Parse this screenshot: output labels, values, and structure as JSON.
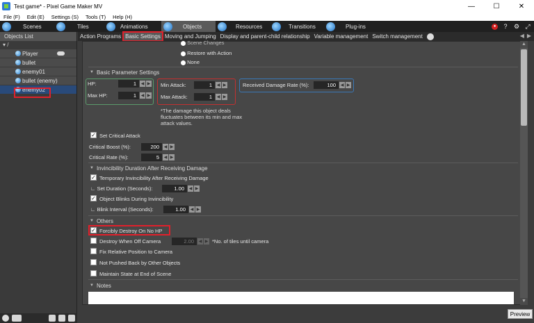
{
  "window": {
    "title": "Test game* - Pixel Game Maker MV",
    "minimize": "—",
    "maximize": "☐",
    "close": "✕"
  },
  "menu": [
    "File (F)",
    "Edit (E)",
    "Settings (S)",
    "Tools (T)",
    "Help (H)"
  ],
  "main_tabs": [
    {
      "label": "Scenes",
      "active": false
    },
    {
      "label": "Tiles",
      "active": false
    },
    {
      "label": "Animations",
      "active": false
    },
    {
      "label": "Objects",
      "active": true
    },
    {
      "label": "Resources",
      "active": false
    },
    {
      "label": "Transitions",
      "active": false
    },
    {
      "label": "Plug-ins",
      "active": false
    }
  ],
  "right_tools": {
    "help": "?",
    "settings": "⚙",
    "expand": "⤢"
  },
  "objects_list": {
    "header": "Objects List",
    "root": "▾ /",
    "items": [
      {
        "label": "Player",
        "selected": false
      },
      {
        "label": "bullet",
        "selected": false
      },
      {
        "label": "enemy01",
        "selected": false
      },
      {
        "label": "bullet (enemy)",
        "selected": false
      },
      {
        "label": "enemy02",
        "selected": true
      }
    ]
  },
  "sub_tabs": [
    {
      "label": "Action Programs",
      "active": false
    },
    {
      "label": "Basic Settings",
      "active": true
    },
    {
      "label": "Moving and Jumping",
      "active": false
    },
    {
      "label": "Display and parent-child relationship",
      "active": false
    },
    {
      "label": "Variable management",
      "active": false
    },
    {
      "label": "Switch management",
      "active": false
    }
  ],
  "radios": {
    "partial": "Scene Changes",
    "restore": "Restore with Action",
    "none": "None"
  },
  "basic_params": {
    "section": "Basic Parameter Settings",
    "hp_label": "HP:",
    "hp_value": "1",
    "max_hp_label": "Max HP:",
    "max_hp_value": "1",
    "min_attack_label": "Min Attack:",
    "min_attack_value": "1",
    "max_attack_label": "Max Attack:",
    "max_attack_value": "1",
    "received_damage_label": "Received Damage Rate (%):",
    "received_damage_value": "100",
    "damage_note": "*The damage this object deals fluctuates between its min and max attack values."
  },
  "critical": {
    "label": "Set Critical Attack",
    "checked": true,
    "boost_label": "Critical Boost (%):",
    "boost_value": "200",
    "rate_label": "Critical Rate (%):",
    "rate_value": "5"
  },
  "invincibility": {
    "section": "Invincibility Duration After Receiving Damage",
    "temp_label": "Temporary Invincibility After Receiving Damage",
    "temp_checked": true,
    "duration_label": "Set Duration (Seconds):",
    "duration_value": "1.00",
    "blink_label": "Object Blinks During Invincibility",
    "blink_checked": true,
    "blink_interval_label": "Blink Interval (Seconds):",
    "blink_interval_value": "1.00"
  },
  "others": {
    "section": "Others",
    "force_destroy": "Forcibly Destroy On No HP",
    "force_destroy_checked": true,
    "destroy_off_camera": "Destroy When Off Camera",
    "destroy_off_camera_value": "2.00",
    "tiles_note": "*No. of tiles until camera",
    "fix_position": "Fix Relative Position to Camera",
    "not_pushed": "Not Pushed Back by Other Objects",
    "maintain_state": "Maintain State at End of Scene"
  },
  "notes": {
    "section": "Notes"
  },
  "preview_button": "Preview",
  "colors": {
    "highlight": "#e2202b",
    "group_green": "#5b9a6b",
    "group_red": "#c43030",
    "group_blue": "#3a78b8",
    "selected_row": "#294a7a"
  }
}
